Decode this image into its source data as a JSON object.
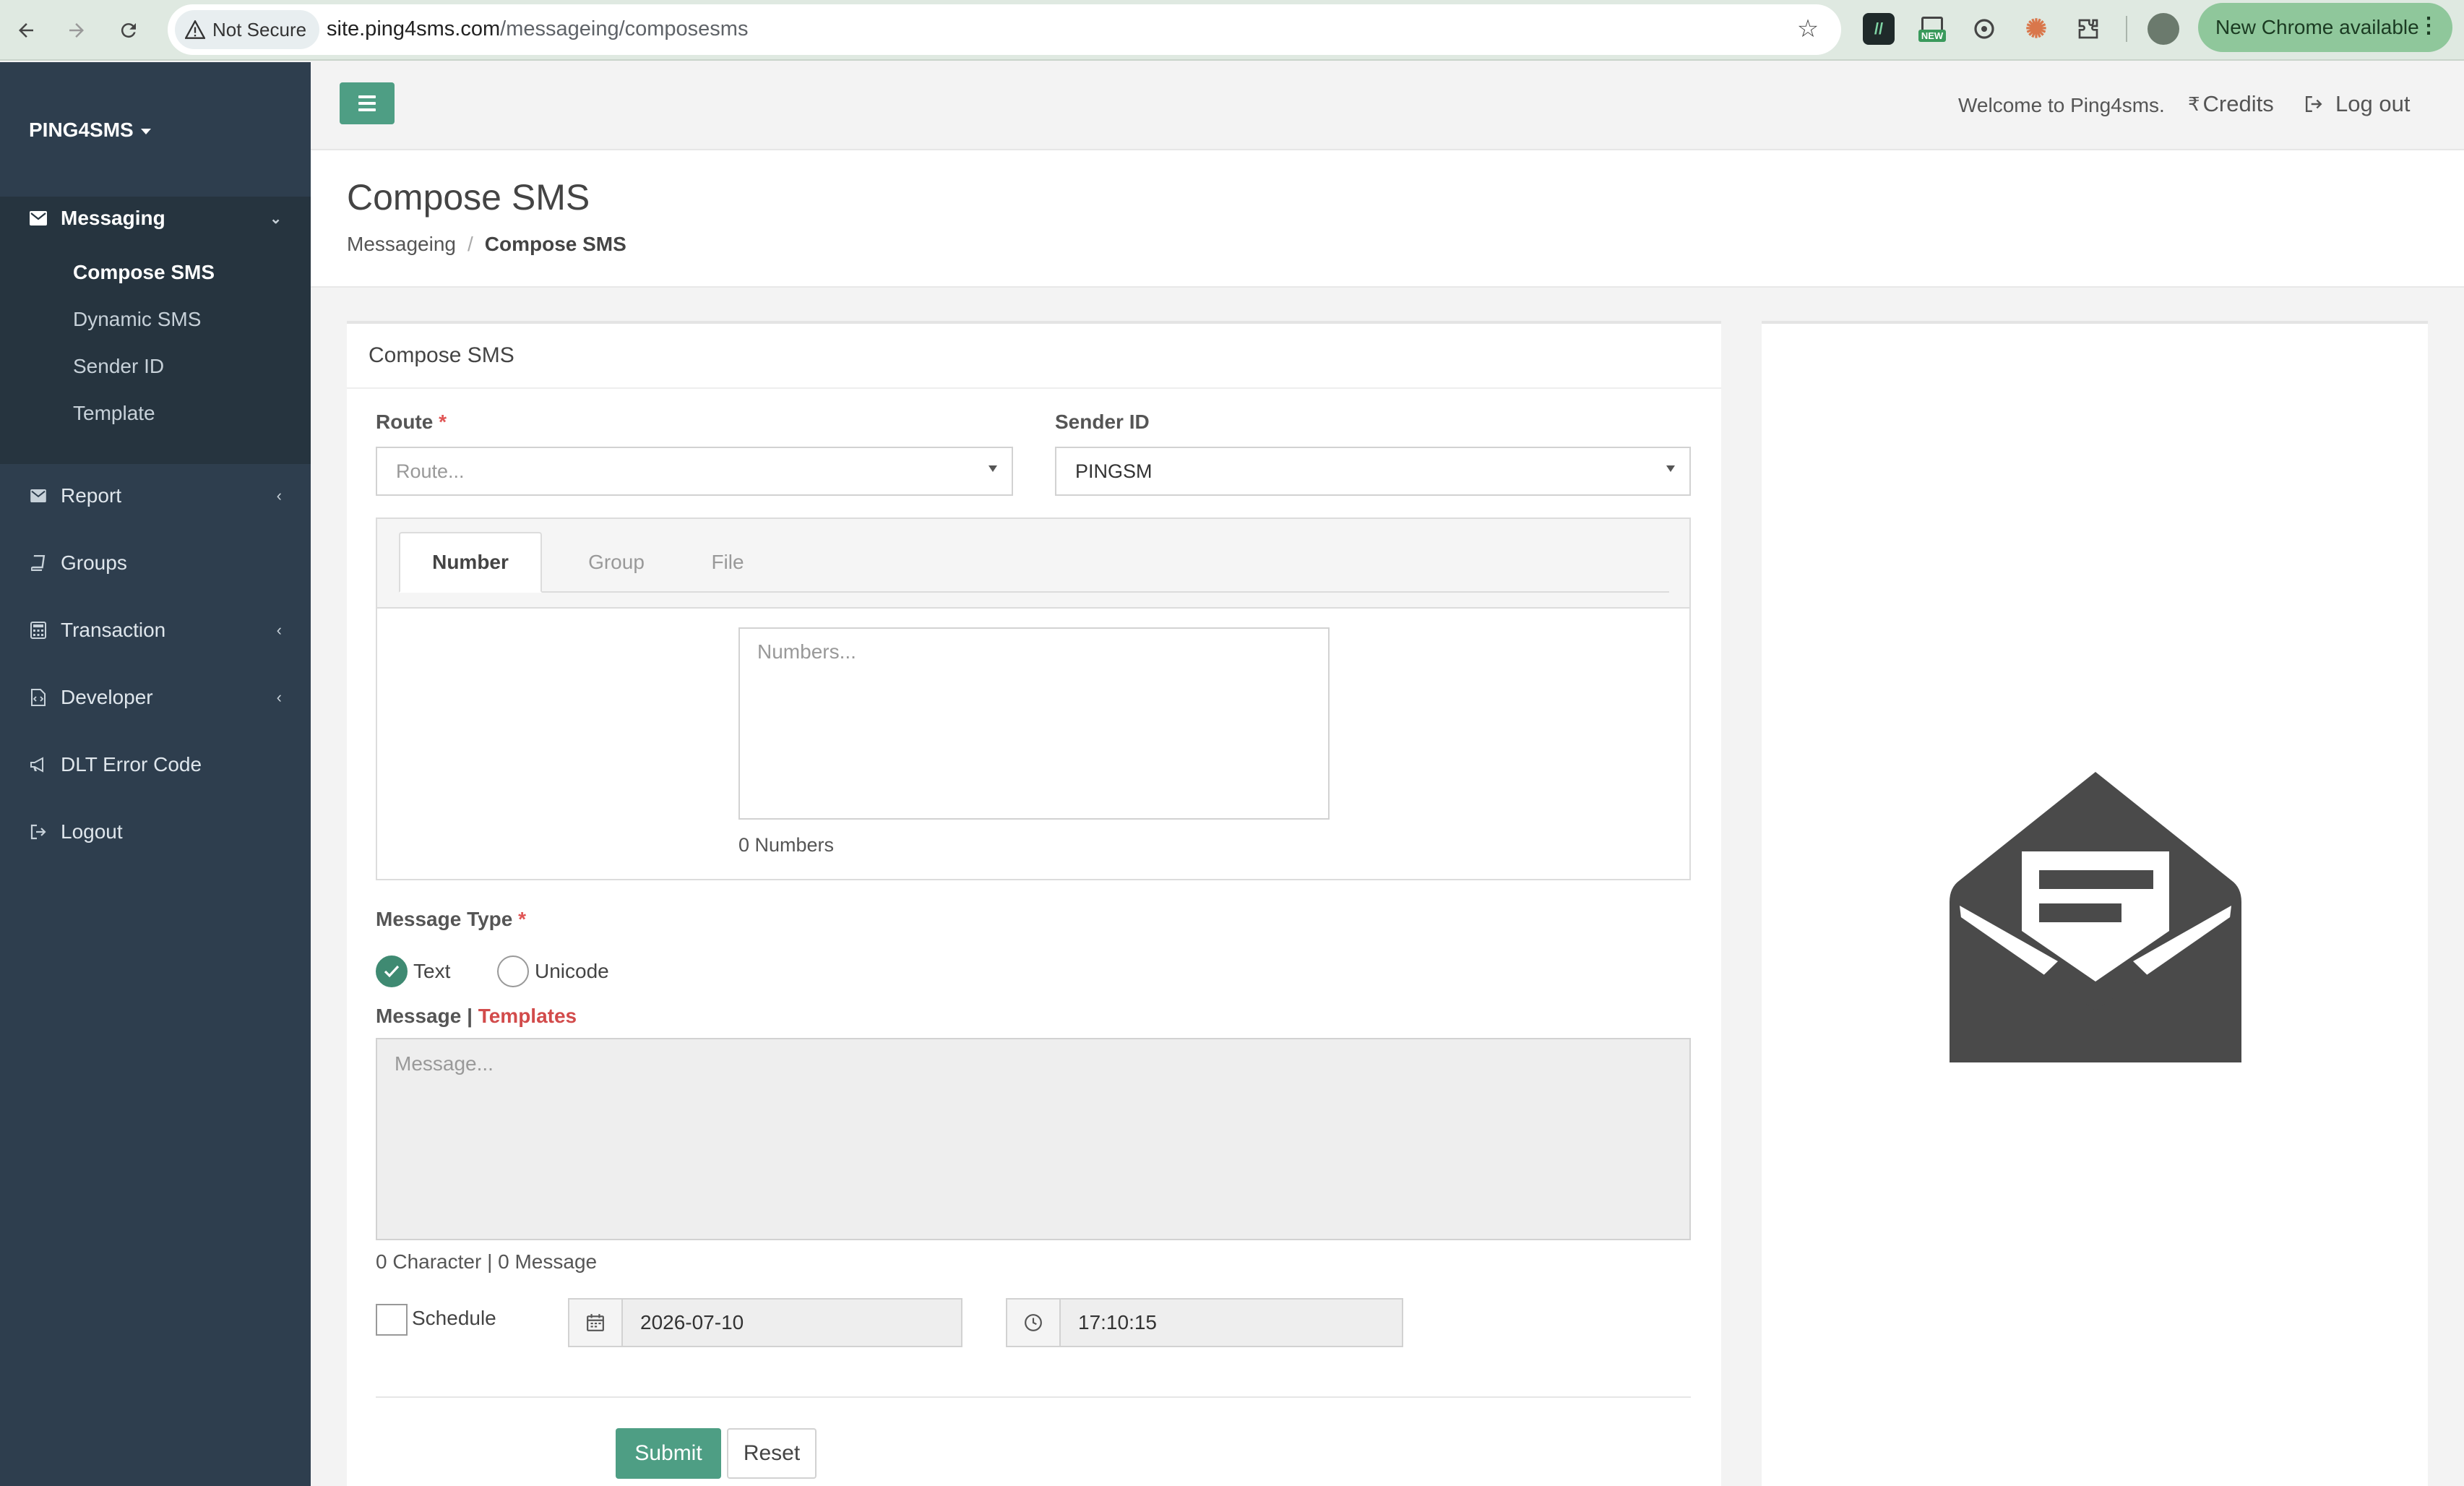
{
  "browser": {
    "security_label": "Not Secure",
    "url_host": "site.ping4sms.com",
    "url_path": "/messageing/composesms",
    "ext_new_badge": "NEW",
    "update_label": "New Chrome available",
    "colors": {
      "chrome_bg": "#dfe9e1",
      "update_btn": "#8fc79b"
    }
  },
  "sidebar": {
    "brand": "PING4SMS",
    "messaging_label": "Messaging",
    "subitems": [
      "Compose SMS",
      "Dynamic SMS",
      "Sender ID",
      "Template"
    ],
    "items": [
      {
        "label": "Report",
        "icon": "envelope-icon",
        "has_chevron": true
      },
      {
        "label": "Groups",
        "icon": "book-icon",
        "has_chevron": false
      },
      {
        "label": "Transaction",
        "icon": "calculator-icon",
        "has_chevron": true
      },
      {
        "label": "Developer",
        "icon": "file-code-icon",
        "has_chevron": true
      },
      {
        "label": "DLT Error Code",
        "icon": "bullhorn-icon",
        "has_chevron": false
      },
      {
        "label": "Logout",
        "icon": "sign-out-icon",
        "has_chevron": false
      }
    ],
    "colors": {
      "bg": "#2e3e4e",
      "active_block": "#26343f"
    }
  },
  "topbar": {
    "welcome": "Welcome to Ping4sms.",
    "credits_symbol": "₹",
    "credits": "Credits",
    "logout": "Log out",
    "accent": "#4e9e84"
  },
  "header": {
    "title": "Compose SMS",
    "breadcrumb_parent": "Messageing",
    "breadcrumb_sep": "/",
    "breadcrumb_current": "Compose SMS"
  },
  "form": {
    "card_title": "Compose SMS",
    "route_label": "Route",
    "required_mark": "*",
    "route_placeholder": "Route...",
    "sender_label": "Sender ID",
    "sender_value": "PINGSM",
    "tabs": [
      "Number",
      "Group",
      "File"
    ],
    "active_tab": "Number",
    "numbers_placeholder": "Numbers...",
    "numbers_count": "0 Numbers",
    "message_type_label": "Message Type",
    "types": [
      "Text",
      "Unicode"
    ],
    "selected_type": "Text",
    "message_label": "Message",
    "pipe": "|",
    "templates_link": "Templates",
    "message_placeholder": "Message...",
    "counter": "0 Character | 0 Message",
    "schedule_label": "Schedule",
    "schedule_checked": false,
    "date_value": "2026-07-10",
    "time_value": "17:10:15",
    "submit": "Submit",
    "reset": "Reset",
    "colors": {
      "templates_link": "#d24b4b",
      "submit_bg": "#4e9e84",
      "radio_on": "#3f8a72"
    }
  },
  "illustration": {
    "icon": "open-envelope-message-icon",
    "color": "#4a4a4a"
  }
}
